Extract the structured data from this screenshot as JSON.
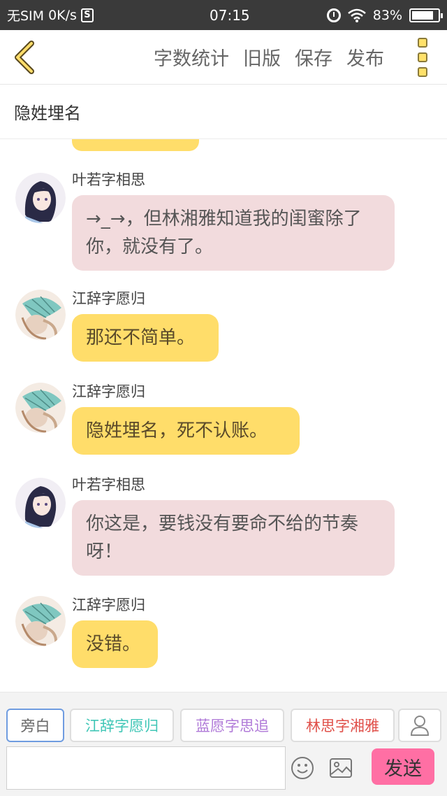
{
  "status_bar": {
    "carrier": "无SIM",
    "net_speed": "0K/s",
    "sim_badge": "S",
    "time": "07:15",
    "battery": "83%",
    "battery_level": 0.83
  },
  "toolbar": {
    "back_icon": "chevron-left-icon",
    "word_count": "字数统计",
    "old_version": "旧版",
    "save": "保存",
    "publish": "发布",
    "more_icon": "more-vertical-icon"
  },
  "title": "隐姓埋名",
  "messages": [
    {
      "sender": "叶若字相思",
      "text": "→_→，但林湘雅知道我的闺蜜除了你，就没有了。",
      "style": "pink"
    },
    {
      "sender": "江辞字愿归",
      "text": "那还不简单。",
      "style": "yellow"
    },
    {
      "sender": "江辞字愿归",
      "text": "隐姓埋名，死不认账。",
      "style": "yellow"
    },
    {
      "sender": "叶若字相思",
      "text": "你这是，要钱没有要命不给的节奏呀！",
      "style": "pink"
    },
    {
      "sender": "江辞字愿归",
      "text": "没错。",
      "style": "yellow"
    }
  ],
  "roles": [
    {
      "label": "旁白",
      "color": "#666666"
    },
    {
      "label": "江辞字愿归",
      "color": "#3fc6b6"
    },
    {
      "label": "蓝愿字思追",
      "color": "#b07ad8"
    },
    {
      "label": "林思字湘雅",
      "color": "#e0504a"
    }
  ],
  "input": {
    "value": "",
    "send": "发送"
  },
  "colors": {
    "accent_yellow": "#ffdd6a",
    "bubble_pink": "#f2dbdd",
    "send_pink": "#ff6fa4"
  }
}
